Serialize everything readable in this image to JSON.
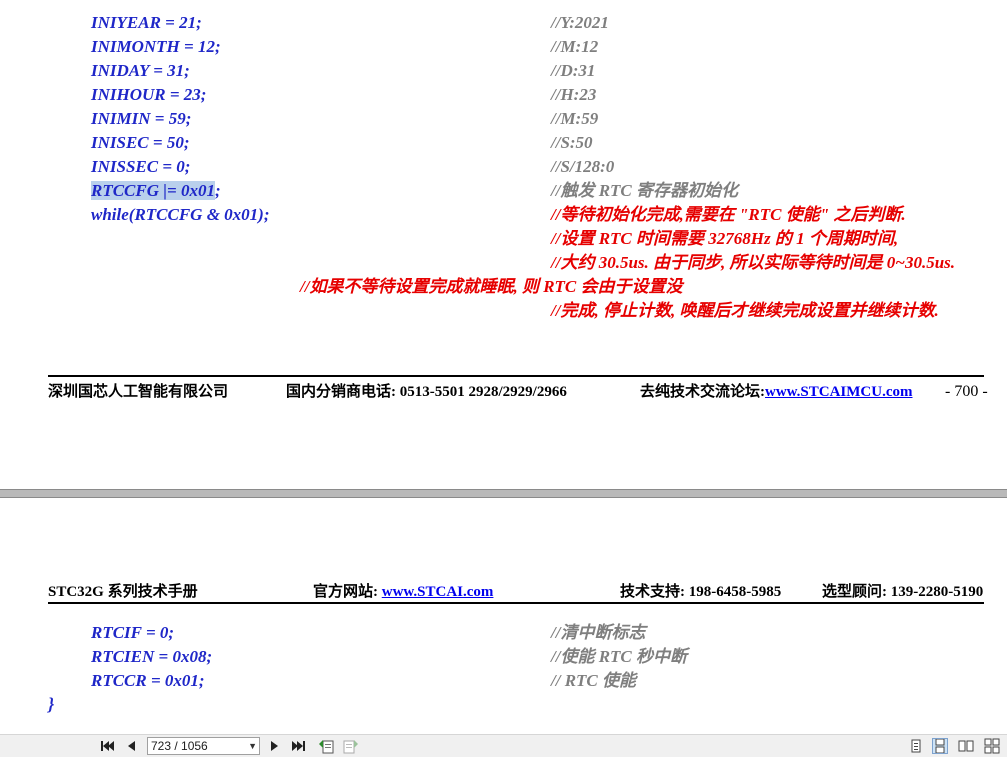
{
  "page1": {
    "code_lines": [
      {
        "code": "INIYEAR = 21;",
        "comment": "//Y:2021"
      },
      {
        "code": "INIMONTH = 12;",
        "comment": "//M:12"
      },
      {
        "code": "INIDAY = 31;",
        "comment": "//D:31"
      },
      {
        "code": "INIHOUR = 23;",
        "comment": "//H:23"
      },
      {
        "code": "INIMIN = 59;",
        "comment": "//M:59"
      },
      {
        "code": "INISEC = 50;",
        "comment": "//S:50"
      },
      {
        "code": "INISSEC = 0;",
        "comment": "//S/128:0"
      }
    ],
    "rtccfg_line": {
      "code_selected": "RTCCFG |= 0x01",
      "code_rest": ";",
      "comment": "//触发 RTC 寄存器初始化"
    },
    "while_line": {
      "code": "while(RTCCFG & 0x01);",
      "comment": "//等待初始化完成,需要在 \"RTC 使能\" 之后判断."
    },
    "red_comments": [
      "//设置 RTC 时间需要 32768Hz 的 1 个周期时间,",
      "//大约 30.5us. 由于同步, 所以实际等待时间是 0~30.5us.",
      "//如果不等待设置完成就睡眠, 则 RTC 会由于设置没",
      "//完成, 停止计数, 唤醒后才继续完成设置并继续计数."
    ],
    "footer": {
      "company": "深圳国芯人工智能有限公司",
      "distributor_label": "国内分销商电话: 0513-5501 2928/2929/2966",
      "forum_label": "去纯技术交流论坛:",
      "forum_link": "www.STCAIMCU.com",
      "page_number": "- 700 -"
    }
  },
  "page2": {
    "header": {
      "manual_title": "STC32G 系列技术手册",
      "website_label": "官方网站: ",
      "website_link": "www.STCAI.com",
      "support": "技术支持: 198-6458-5985",
      "consultant": "选型顾问: 139-2280-5190"
    },
    "code_lines": [
      {
        "code": "RTCIF = 0;",
        "comment": "//清中断标志"
      },
      {
        "code": "RTCIEN = 0x08;",
        "comment": "//使能 RTC 秒中断"
      },
      {
        "code": "RTCCR = 0x01;",
        "comment": "// RTC 使能"
      }
    ],
    "closing_brace": "}"
  },
  "toolbar": {
    "page_indicator": "723 / 1056",
    "icons": [
      "first-page-icon",
      "prev-page-icon",
      "next-page-icon",
      "last-page-icon",
      "go-back-icon",
      "go-forward-icon",
      "single-page-view-icon",
      "continuous-view-icon",
      "facing-view-icon",
      "facing-continuous-view-icon"
    ]
  }
}
